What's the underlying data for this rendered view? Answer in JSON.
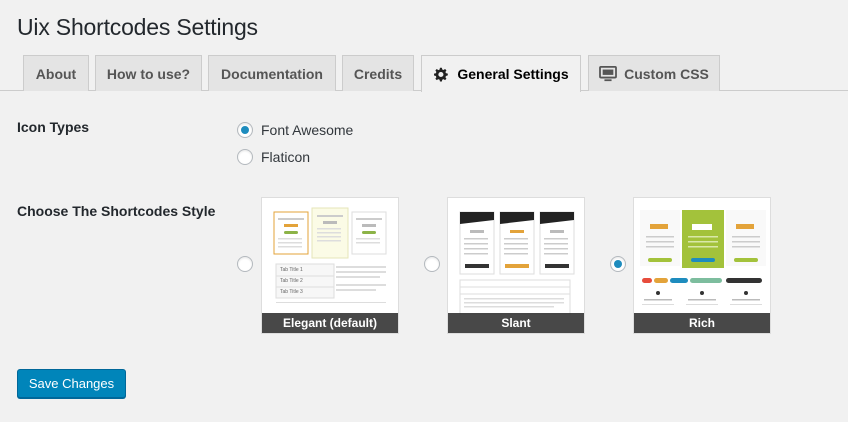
{
  "page": {
    "title": "Uix Shortcodes Settings"
  },
  "tabs": [
    {
      "label": "About",
      "active": false
    },
    {
      "label": "How to use?",
      "active": false
    },
    {
      "label": "Documentation",
      "active": false
    },
    {
      "label": "Credits",
      "active": false
    },
    {
      "label": "General Settings",
      "active": true,
      "icon": "gear-icon"
    },
    {
      "label": "Custom CSS",
      "active": false,
      "icon": "monitor-icon"
    }
  ],
  "icon_types": {
    "label": "Icon Types",
    "options": [
      {
        "label": "Font Awesome",
        "checked": true
      },
      {
        "label": "Flaticon",
        "checked": false
      }
    ]
  },
  "shortcodes_style": {
    "label": "Choose The Shortcodes Style",
    "options": [
      {
        "caption": "Elegant (default)",
        "checked": false
      },
      {
        "caption": "Slant",
        "checked": false
      },
      {
        "caption": "Rich",
        "checked": true
      }
    ],
    "preview_text": {
      "elegant_tabs": [
        "Tab Title 1",
        "Tab Title 2",
        "Tab Title 3"
      ]
    }
  },
  "actions": {
    "save_label": "Save Changes"
  },
  "colors": {
    "accent": "#0085ba",
    "radio_checked": "#1e8cbe",
    "rich_green": "#a3c23b",
    "orange": "#e3a33a"
  }
}
